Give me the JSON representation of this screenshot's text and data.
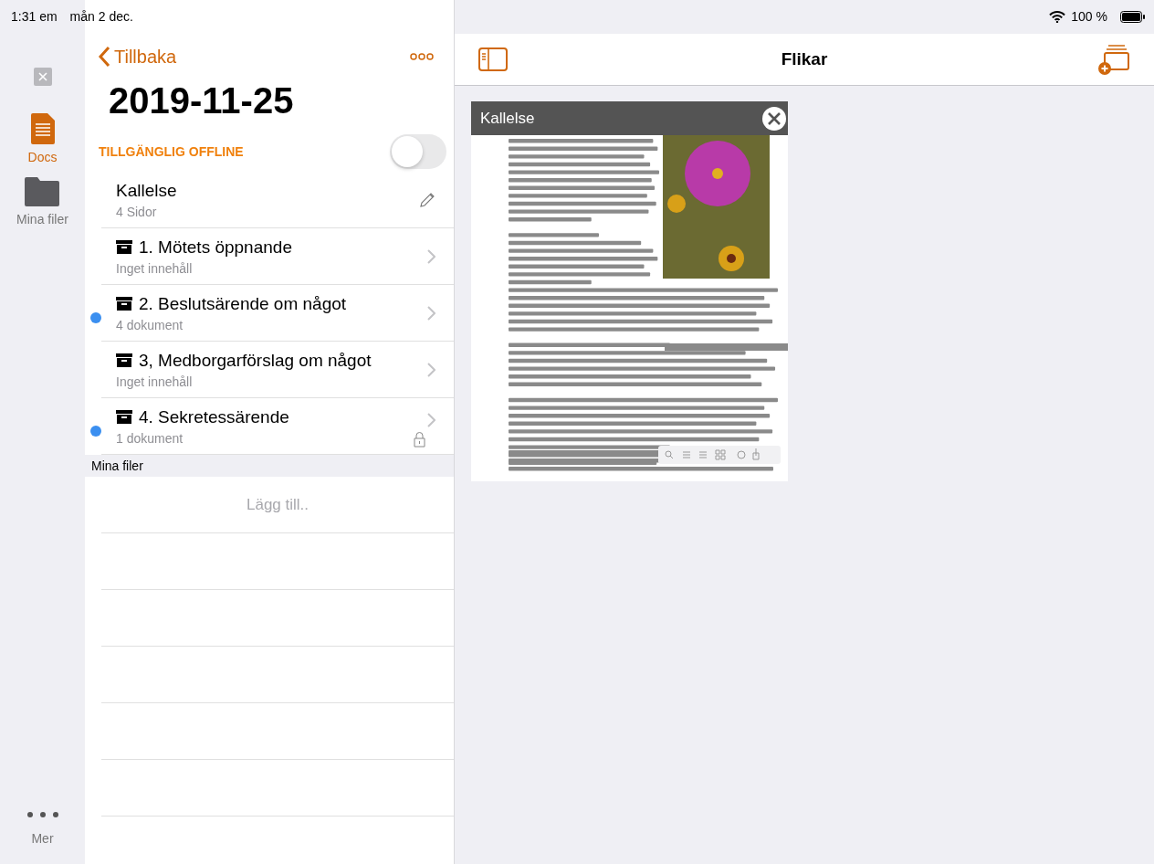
{
  "status_bar": {
    "time": "1:31 em",
    "date": "mån 2 dec.",
    "battery": "100 %"
  },
  "sidebar": {
    "items": [
      {
        "label": "Docs",
        "selected": true
      },
      {
        "label": "Mina filer",
        "selected": false
      }
    ],
    "more": {
      "label": "Mer"
    }
  },
  "list_panel": {
    "back": "Tillbaka",
    "title": "2019-11-25",
    "offline": {
      "label": "TILLGÄNGLIG OFFLINE",
      "on": false
    },
    "rows": [
      {
        "kind": "document",
        "title": "Kallelse",
        "subtitle": "4 Sidor",
        "unread": false,
        "locked": false
      },
      {
        "kind": "folder",
        "title": "1. Mötets öppnande",
        "subtitle": "Inget innehåll",
        "unread": false,
        "locked": false
      },
      {
        "kind": "folder",
        "title": "2. Beslutsärende om något",
        "subtitle": "4 dokument",
        "unread": true,
        "locked": false
      },
      {
        "kind": "folder",
        "title": "3, Medborgarförslag om något",
        "subtitle": "Inget innehåll",
        "unread": false,
        "locked": false
      },
      {
        "kind": "folder",
        "title": "4. Sekretessärende",
        "subtitle": "1 dokument",
        "unread": true,
        "locked": true
      }
    ],
    "section": "Mina filer",
    "add": "Lägg till.."
  },
  "tabs_panel": {
    "title": "Flikar",
    "tabs": [
      {
        "title": "Kallelse"
      }
    ]
  }
}
